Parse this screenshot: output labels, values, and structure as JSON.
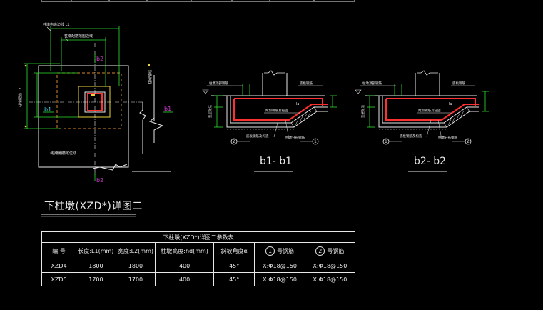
{
  "drawing": {
    "title": "下柱墩(XZD*)详图二",
    "labels": {
      "b1_left": "b1",
      "b1_right": "b1",
      "b2_top": "b2",
      "b2_bottom": "b2",
      "plan_top": "柱墩构造边线 L1",
      "plan_top2": "柱墩配筋范围边线",
      "plan_left": "柱墩配筋 L2",
      "plan_right": "柱网轴线",
      "plan_bottom": "柱墩钢筋定位线"
    },
    "sections": {
      "b1": {
        "label": "b1- b1",
        "marker_left": "2",
        "marker_right": "1"
      },
      "b2": {
        "label": "b2- b2",
        "marker_left": "1",
        "marker_right": "2"
      },
      "notes": {
        "top": "柱墩顶部钢筋",
        "middle": "附加钢筋及锚固",
        "bottom": "底板钢筋及构造",
        "side": "垫层做法",
        "la": "la",
        "slab": "底板钢筋",
        "anchor": "柱墩分布钢筋"
      }
    }
  },
  "table": {
    "caption": "下柱墩(XZD*)详图二参数表",
    "headers": [
      "编  号",
      "长度:L1(mm)",
      "宽度:L2(mm)",
      "柱墩高度:hd(mm)",
      "斜坡角度α",
      "1 号钢筋",
      "2 号钢筋"
    ],
    "header_markers": [
      "",
      "",
      "",
      "",
      "",
      "1",
      "2"
    ],
    "rows": [
      [
        "XZD4",
        "1800",
        "1800",
        "400",
        "45°",
        "X:Φ18@150",
        "X:Φ18@150"
      ],
      [
        "XZD5",
        "1700",
        "1700",
        "400",
        "45°",
        "X:Φ18@150",
        "X:Φ18@150"
      ]
    ]
  },
  "colors": {
    "background": "#000000",
    "green": "#2ee02e",
    "yellow": "#e8d33a",
    "red": "#ff3030",
    "orange": "#d9862a",
    "white": "#e8e8e8",
    "cyan": "#3fd7e0",
    "magenta": "#d33ad3"
  }
}
